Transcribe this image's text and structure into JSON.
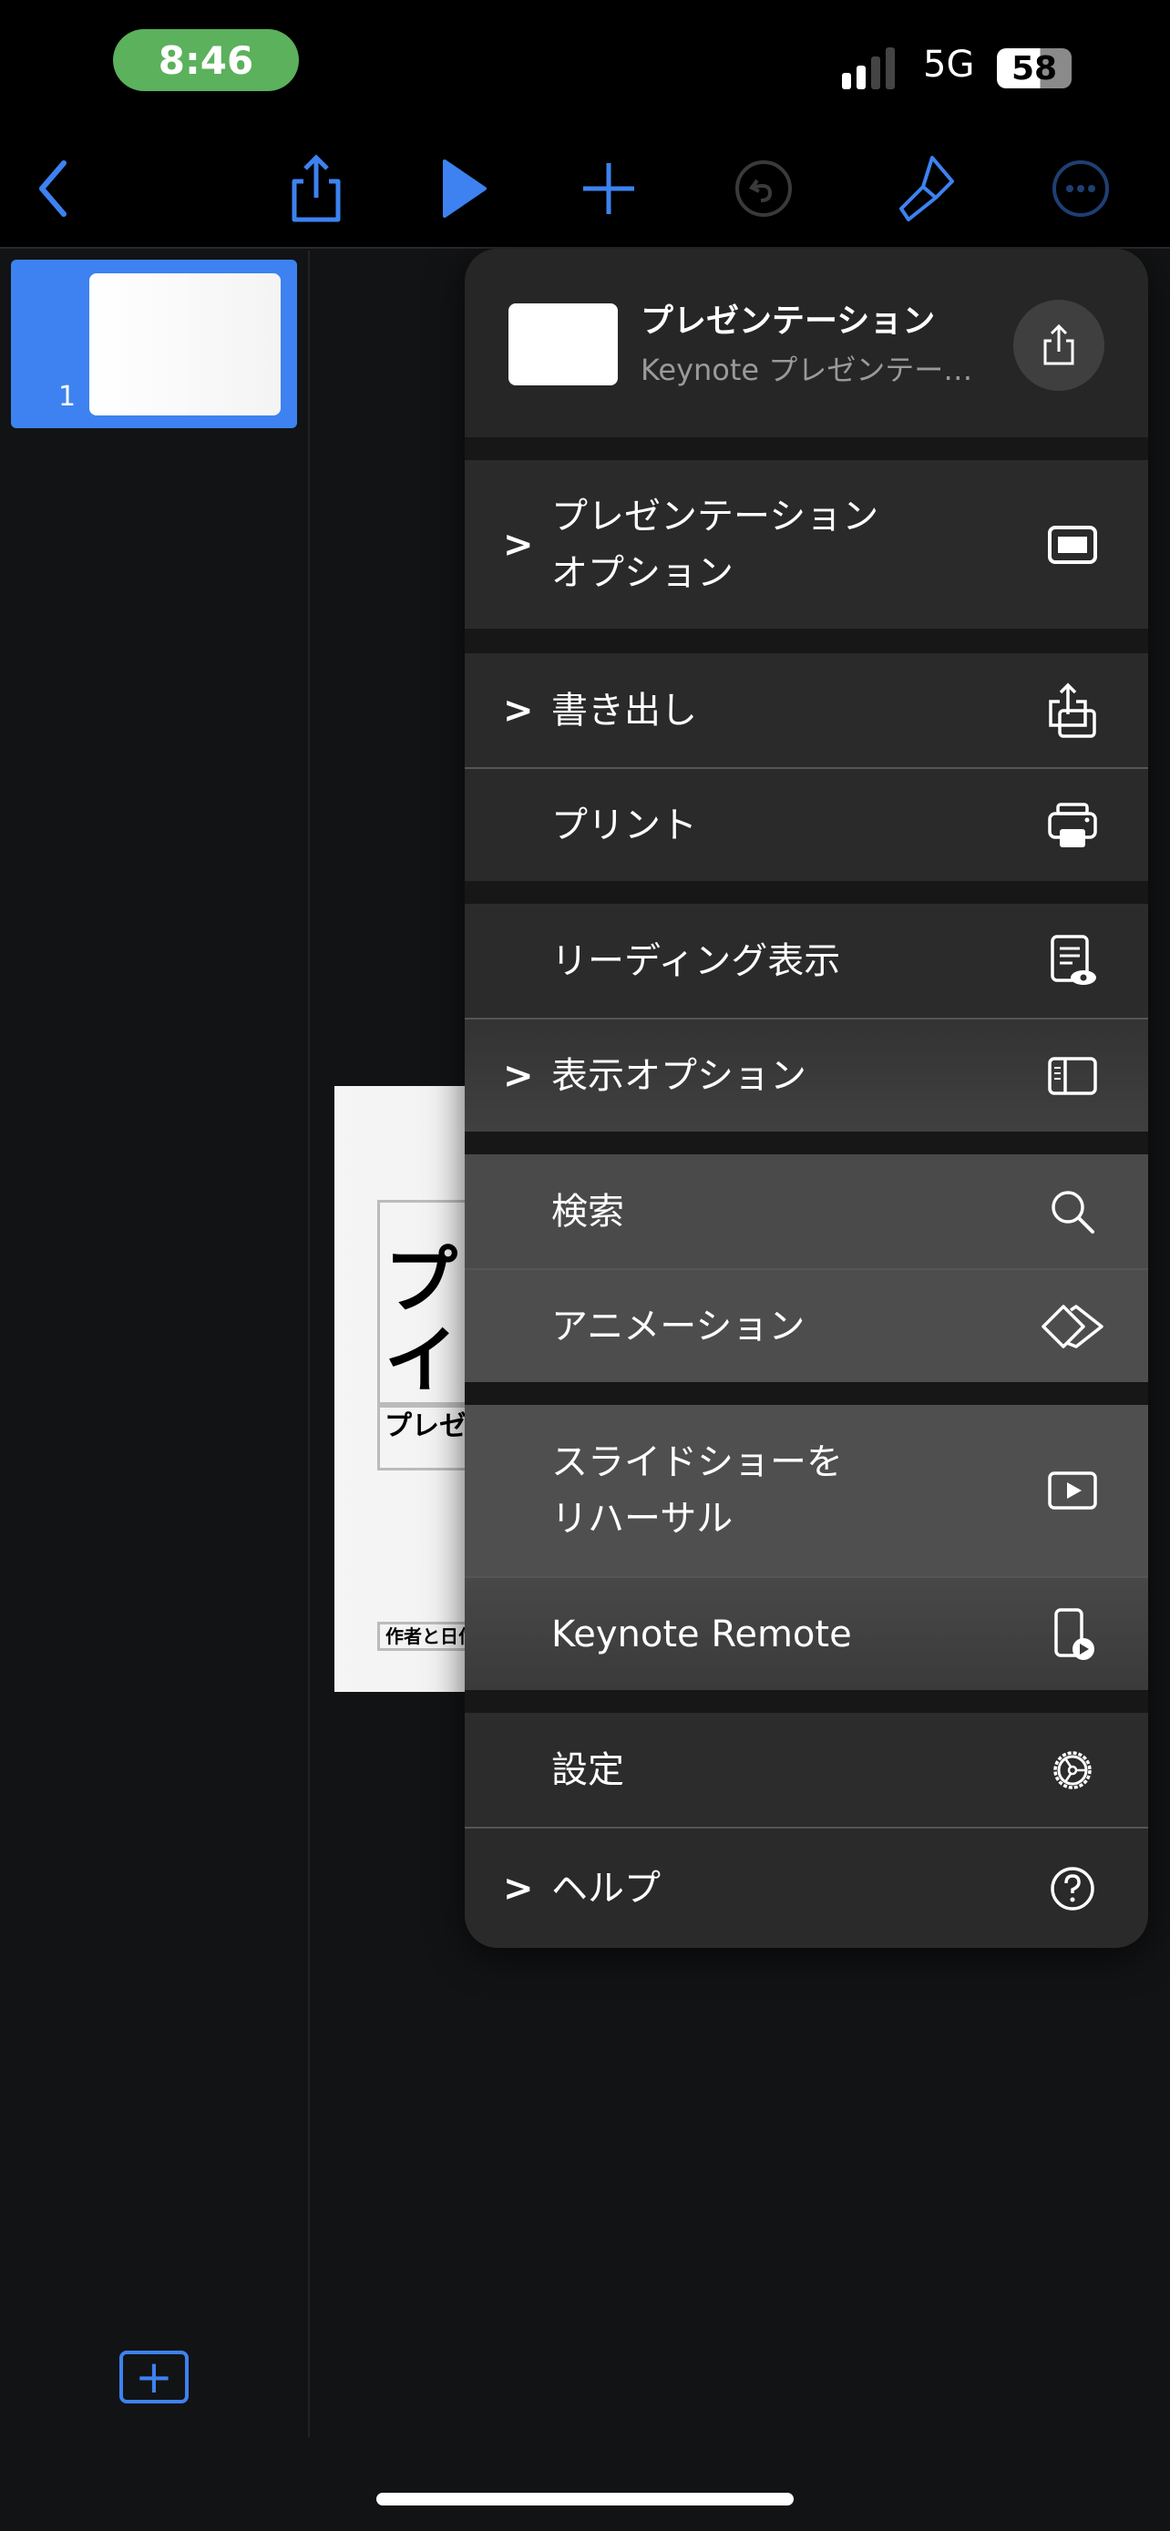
{
  "status_bar": {
    "time": "8:46",
    "network": "5G",
    "battery": "58"
  },
  "toolbar": {
    "icons": [
      "back-icon",
      "share-icon",
      "play-icon",
      "add-icon",
      "undo-icon",
      "format-brush-icon",
      "more-icon"
    ]
  },
  "sidebar": {
    "slide_number": "1",
    "add_slide_label": "+"
  },
  "slide": {
    "title": "プレゼンテーション\nイトル",
    "title_line1": "プレ",
    "title_line2": "イト",
    "subtitle": "プレゼ",
    "author": "作者と日付"
  },
  "menu": {
    "header": {
      "title": "プレゼンテーション",
      "subtitle": "Keynote プレゼンテー…"
    },
    "items": [
      {
        "label": "プレゼンテーション\nオプション",
        "icon": "presentation-icon",
        "chevron": ">"
      },
      {
        "label": "書き出し",
        "icon": "export-icon",
        "chevron": ">"
      },
      {
        "label": "プリント",
        "icon": "printer-icon"
      },
      {
        "label": "リーディング表示",
        "icon": "reading-view-icon"
      },
      {
        "label": "表示オプション",
        "icon": "sidebar-view-icon",
        "chevron": ">"
      },
      {
        "label": "検索",
        "icon": "search-icon"
      },
      {
        "label": "アニメーション",
        "icon": "animation-icon"
      },
      {
        "label": "スライドショーを\nリハーサル",
        "icon": "rehearse-play-icon"
      },
      {
        "label": "Keynote Remote",
        "icon": "remote-icon"
      },
      {
        "label": "設定",
        "icon": "gear-icon"
      },
      {
        "label": "ヘルプ",
        "icon": "help-icon",
        "chevron": ">"
      }
    ]
  },
  "colors": {
    "accent": "#3d82f0",
    "time_pill": "#5bb15c"
  }
}
